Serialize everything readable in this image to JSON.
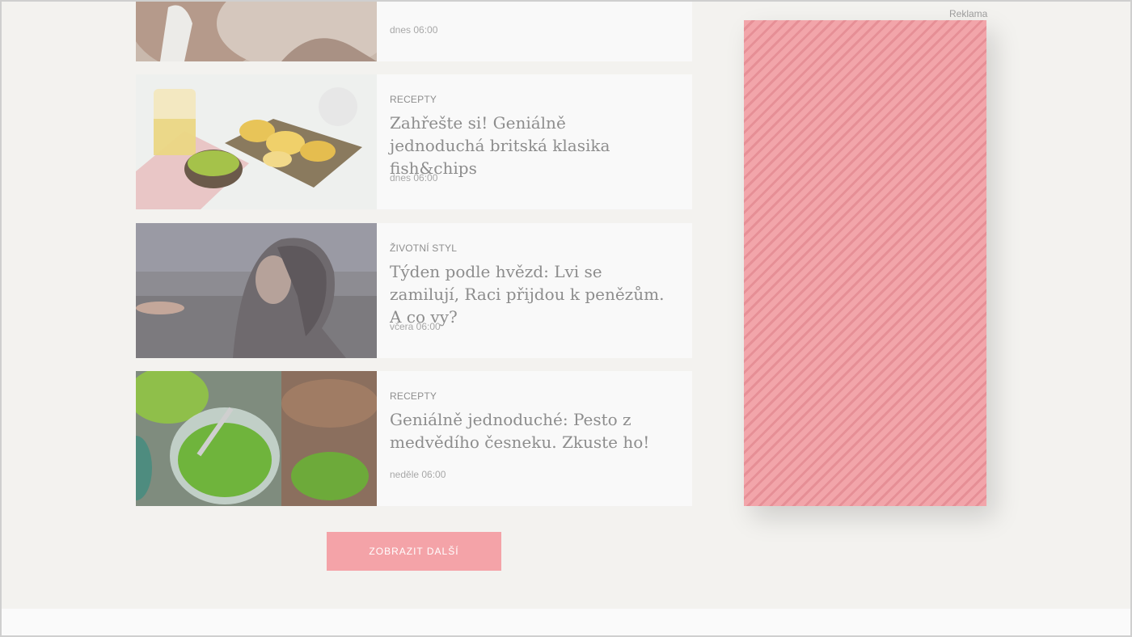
{
  "articles": [
    {
      "category": "",
      "title": "",
      "date": "dnes 06:00",
      "image": "woman-hug-photo"
    },
    {
      "category": "RECEPTY",
      "title": "Zahřešte si! Geniálně jednoduchá britská klasika fish&chips",
      "date": "dnes 06:00",
      "image": "fish-and-chips-photo"
    },
    {
      "category": "ŽIVOTNÍ STYL",
      "title": "Týden podle hvězd: Lvi se zamilují, Raci přijdou k penězům. A co vy?",
      "date": "včera 06:00",
      "image": "woman-sunset-photo"
    },
    {
      "category": "RECEPTY",
      "title": "Geniálně jednoduché: Pesto z medvědího česneku. Zkuste ho!",
      "date": "neděle 06:00",
      "image": "pesto-jar-photo"
    }
  ],
  "load_more": {
    "label": "ZOBRAZIT DALŠÍ"
  },
  "ad": {
    "label": "Reklama",
    "color": "#f2a5aa"
  }
}
